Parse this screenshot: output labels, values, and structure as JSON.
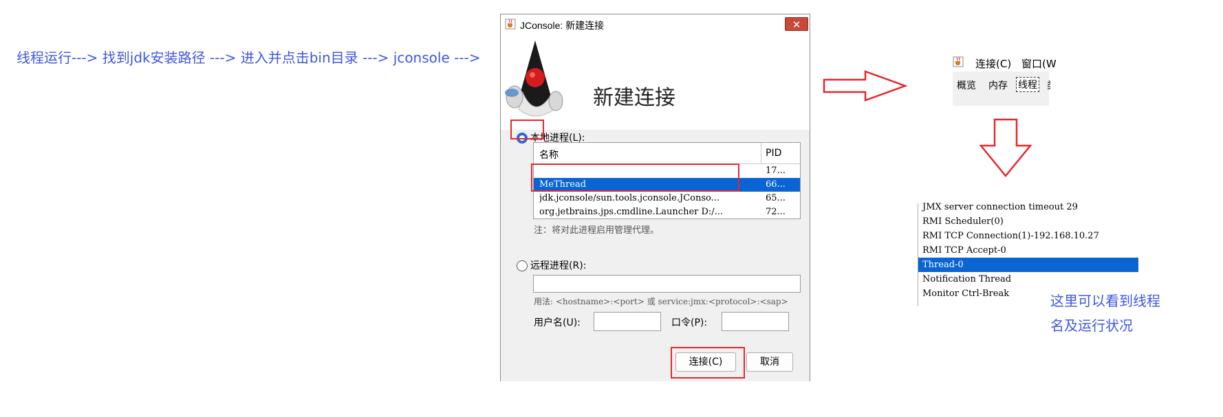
{
  "instruction": "线程运行---> 找到jdk安装路径 ---> 进入并点击bin目录 ---> jconsole --->",
  "dialog": {
    "title": "JConsole: 新建连接",
    "close_glyph": "✕",
    "header_title": "新建连接",
    "local_process_label": "本地进程(L):",
    "table": {
      "columns": [
        "名称",
        "PID"
      ],
      "rows": [
        {
          "name": "",
          "pid": "17..."
        },
        {
          "name": "MeThread",
          "pid": "66...",
          "selected": true
        },
        {
          "name": "jdk.jconsole/sun.tools.jconsole.JConso...",
          "pid": "65..."
        },
        {
          "name": "org.jetbrains.jps.cmdline.Launcher D:/...",
          "pid": "72..."
        }
      ]
    },
    "note": "注：将对此进程启用管理代理。",
    "remote_process_label": "远程进程(R):",
    "remote_input_value": "",
    "usage": "用法: <hostname>:<port> 或 service:jmx:<protocol>:<sap>",
    "username_label": "用户名(U):",
    "password_label": "口令(P):",
    "connect_button": "连接(C)",
    "cancel_button": "取消"
  },
  "menu_snippet": {
    "items": [
      "连接(C)",
      "窗口(W"
    ],
    "tabs": [
      "概览",
      "内存",
      "线程",
      "类"
    ],
    "active_tab": "线程"
  },
  "thread_list": {
    "threads": [
      {
        "name": "JMX server connection timeout 29"
      },
      {
        "name": "RMI Scheduler(0)"
      },
      {
        "name": "RMI TCP Connection(1)-192.168.10.27"
      },
      {
        "name": "RMI TCP Accept-0"
      },
      {
        "name": "Thread-0",
        "selected": true
      },
      {
        "name": "Notification Thread"
      },
      {
        "name": "Monitor Ctrl-Break"
      }
    ]
  },
  "caption": {
    "line1": "这里可以看到线程",
    "line2": "名及运行状况"
  },
  "colors": {
    "accent_text": "#3f57e0",
    "highlight_red": "#e8262b",
    "selection_blue": "#0a64d2"
  }
}
